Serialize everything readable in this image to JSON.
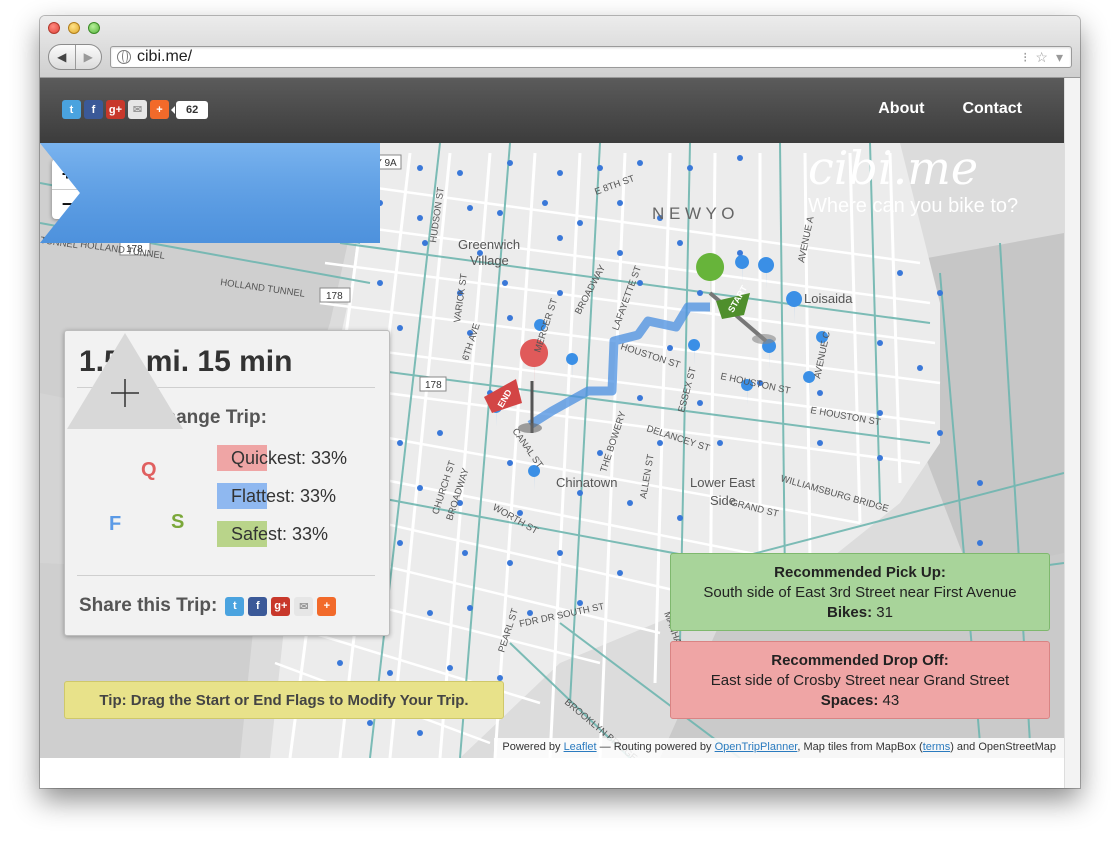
{
  "browser": {
    "url": "cibi.me/"
  },
  "header": {
    "share_count": "62",
    "nav": [
      {
        "label": "About"
      },
      {
        "label": "Contact"
      }
    ]
  },
  "brand": {
    "title": "cibi.me",
    "tagline": "Where can you bike to?"
  },
  "map": {
    "zoom_in": "+",
    "zoom_out": "−",
    "labels": {
      "greenwich": "Greenwich",
      "village": "Village",
      "loisaida": "Loisaida",
      "chinatown": "Chinatown",
      "lower_east": "Lower East",
      "side": "Side",
      "new_york": "N E W   Y O",
      "holland1": "HOLLAND TUNNEL",
      "holland2": "HOLLAND TUNNEL",
      "tunnel": "TUNNEL",
      "ny9a": "NY 9A",
      "r178a": "178",
      "r178b": "178",
      "r178c": "178",
      "houston1": "HOUSTON ST",
      "houston2": "E HOUSTON ST",
      "houston3": "E HOUSTON ST",
      "broadway1": "BROADWAY",
      "broadway2": "BROADWAY",
      "bowery": "THE BOWERY",
      "delancey": "DELANCEY ST",
      "essex": "ESSEX ST",
      "allen": "ALLEN ST",
      "canal": "CANAL ST",
      "church": "CHURCH ST",
      "worth": "WORTH ST",
      "grand": "GRAND ST",
      "williamsburg": "WILLIAMSBURG BRIDGE",
      "manhattan": "MANHATTAN BRIDGE",
      "brooklyn": "BROOKLYN BRIDGE",
      "fdr": "FDR DR SOUTH ST",
      "avenue_a": "AVENUE A",
      "avenue_c": "AVENUE C",
      "varick": "VARICK ST",
      "hudson": "HUDSON ST",
      "lafayette": "LAFAYETTE ST",
      "mercer": "MERCER ST",
      "sixth_ave": "6TH AVE",
      "e8th": "E 8TH ST",
      "pearl": "PEARL ST",
      "start_flag": "START",
      "end_flag": "END"
    }
  },
  "trip": {
    "stats": "1.54 mi. 15 min",
    "drag_label": "Drag to Change Trip:",
    "triangle": {
      "q": "Q",
      "f": "F",
      "s": "S"
    },
    "modes": [
      {
        "label": "Quickest: 33%",
        "percent": 33,
        "color": "#efa5a5"
      },
      {
        "label": "Flattest: 33%",
        "percent": 33,
        "color": "#8fb8f0"
      },
      {
        "label": "Safest: 33%",
        "percent": 33,
        "color": "#b9d48a"
      }
    ],
    "share_label": "Share this Trip:"
  },
  "tip": "Tip: Drag the Start or End Flags to Modify Your Trip.",
  "pickup": {
    "title": "Recommended Pick Up:",
    "location": "South side of East 3rd Street near First Avenue",
    "count_label": "Bikes:",
    "count": "31"
  },
  "dropoff": {
    "title": "Recommended Drop Off:",
    "location": "East side of Crosby Street near Grand Street",
    "count_label": "Spaces:",
    "count": "43"
  },
  "attribution": {
    "powered_by": "Powered by",
    "leaflet": "Leaflet",
    "routing": " — Routing powered by",
    "otp": "OpenTripPlanner",
    "tiles": ", Map tiles from MapBox (",
    "terms": "terms",
    "osm": ") and OpenStreetMap"
  }
}
